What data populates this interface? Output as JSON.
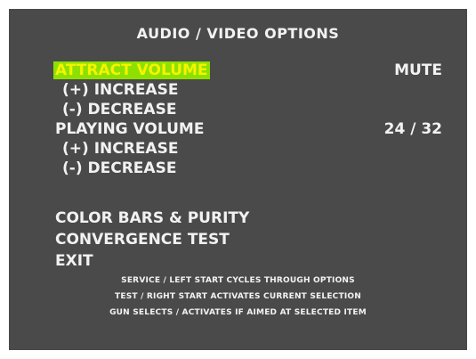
{
  "screen": {
    "title": "AUDIO / VIDEO OPTIONS",
    "colors": {
      "background": "#4a4a4a",
      "text": "#f2f2f2",
      "highlight_bg": "#8ee000",
      "highlight_text": "#f4f400"
    },
    "menu": {
      "attract_volume": {
        "label": "ATTRACT VOLUME",
        "value": "MUTE",
        "selected": true
      },
      "attract_increase": "(+) INCREASE",
      "attract_decrease": "(-) DECREASE",
      "playing_volume": {
        "label": "PLAYING VOLUME",
        "value": "24 / 32"
      },
      "playing_increase": "(+) INCREASE",
      "playing_decrease": "(-) DECREASE",
      "color_bars": "COLOR BARS & PURITY",
      "convergence": "CONVERGENCE TEST",
      "exit": "EXIT"
    },
    "help": {
      "line1": "SERVICE / LEFT START CYCLES THROUGH OPTIONS",
      "line2": "TEST / RIGHT START ACTIVATES CURRENT SELECTION",
      "line3": "GUN SELECTS / ACTIVATES IF AIMED AT SELECTED ITEM"
    }
  }
}
